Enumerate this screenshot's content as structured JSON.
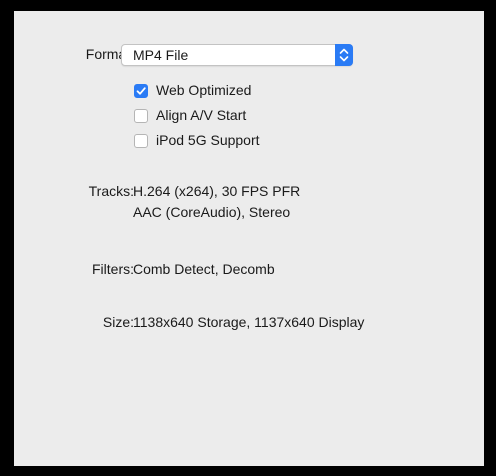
{
  "format": {
    "label": "Format:",
    "selected": "MP4 File"
  },
  "options": [
    {
      "label": "Web Optimized",
      "checked": true
    },
    {
      "label": "Align A/V Start",
      "checked": false
    },
    {
      "label": "iPod 5G Support",
      "checked": false
    }
  ],
  "tracks": {
    "label": "Tracks:",
    "lines": [
      "H.264 (x264), 30 FPS PFR",
      "AAC (CoreAudio), Stereo"
    ]
  },
  "filters": {
    "label": "Filters:",
    "value": "Comb Detect, Decomb"
  },
  "size": {
    "label": "Size:",
    "value": "1138x640 Storage, 1137x640 Display"
  },
  "colors": {
    "accent": "#2a7bf5",
    "panel_background": "#ececec",
    "frame": "#000000"
  }
}
